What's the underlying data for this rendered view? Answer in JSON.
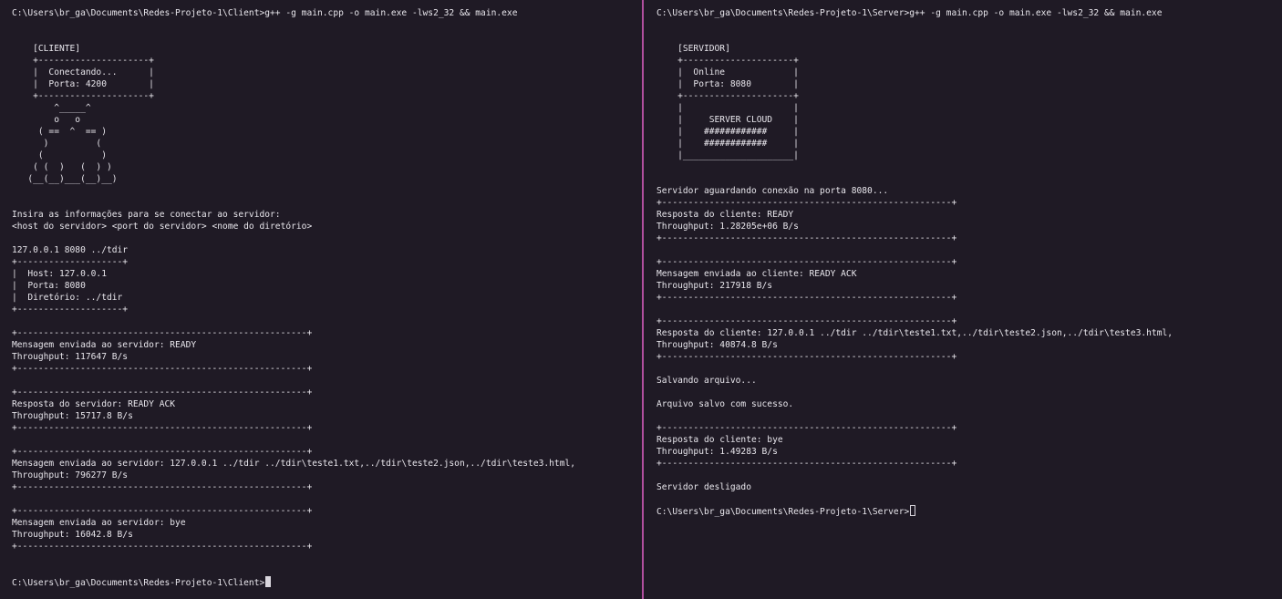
{
  "colors": {
    "background": "#1f1a25",
    "text": "#e8e6ec",
    "divider": "#b04f9e",
    "cursor": "#d9d6dd"
  },
  "client": {
    "lines": [
      "C:\\Users\\br_ga\\Documents\\Redes-Projeto-1\\Client>g++ -g main.cpp -o main.exe -lws2_32 && main.exe",
      "",
      "",
      "    [CLIENTE]",
      "    +---------------------+",
      "    |  Conectando...      |",
      "    |  Porta: 4200        |",
      "    +---------------------+",
      "        ^_____^",
      "        o   o",
      "     ( ==  ^  == )",
      "      )         (",
      "     (           )",
      "    ( (  )   (  ) )",
      "   (__(__)___(__)__)",
      "",
      "",
      "Insira as informações para se conectar ao servidor:",
      "<host do servidor> <port do servidor> <nome do diretório>",
      "",
      "127.0.0.1 8080 ../tdir",
      "+--------------------+",
      "|  Host: 127.0.0.1",
      "|  Porta: 8080",
      "|  Diretório: ../tdir",
      "+--------------------+",
      "",
      "+-------------------------------------------------------+",
      "Mensagem enviada ao servidor: READY",
      "Throughput: 117647 B/s",
      "+-------------------------------------------------------+",
      "",
      "+-------------------------------------------------------+",
      "Resposta do servidor: READY ACK",
      "Throughput: 15717.8 B/s",
      "+-------------------------------------------------------+",
      "",
      "+-------------------------------------------------------+",
      "Mensagem enviada ao servidor: 127.0.0.1 ../tdir ../tdir\\teste1.txt,../tdir\\teste2.json,../tdir\\teste3.html,",
      "Throughput: 796277 B/s",
      "+-------------------------------------------------------+",
      "",
      "+-------------------------------------------------------+",
      "Mensagem enviada ao servidor: bye",
      "Throughput: 16042.8 B/s",
      "+-------------------------------------------------------+",
      "",
      ""
    ],
    "prompt": "C:\\Users\\br_ga\\Documents\\Redes-Projeto-1\\Client>"
  },
  "server": {
    "lines": [
      "C:\\Users\\br_ga\\Documents\\Redes-Projeto-1\\Server>g++ -g main.cpp -o main.exe -lws2_32 && main.exe",
      "",
      "",
      "    [SERVIDOR]",
      "    +---------------------+",
      "    |  Online             |",
      "    |  Porta: 8080        |",
      "    +---------------------+",
      "    |                     |",
      "    |     SERVER CLOUD    |",
      "    |    ############     |",
      "    |    ############     |",
      "    |_____________________|",
      "",
      "",
      "Servidor aguardando conexão na porta 8080...",
      "+-------------------------------------------------------+",
      "Resposta do cliente: READY",
      "Throughput: 1.28205e+06 B/s",
      "+-------------------------------------------------------+",
      "",
      "+-------------------------------------------------------+",
      "Mensagem enviada ao cliente: READY ACK",
      "Throughput: 217918 B/s",
      "+-------------------------------------------------------+",
      "",
      "+-------------------------------------------------------+",
      "Resposta do cliente: 127.0.0.1 ../tdir ../tdir\\teste1.txt,../tdir\\teste2.json,../tdir\\teste3.html,",
      "Throughput: 40874.8 B/s",
      "+-------------------------------------------------------+",
      "",
      "Salvando arquivo...",
      "",
      "Arquivo salvo com sucesso.",
      "",
      "+-------------------------------------------------------+",
      "Resposta do cliente: bye",
      "Throughput: 1.49283 B/s",
      "+-------------------------------------------------------+",
      "",
      "Servidor desligado",
      ""
    ],
    "prompt": "C:\\Users\\br_ga\\Documents\\Redes-Projeto-1\\Server>"
  }
}
